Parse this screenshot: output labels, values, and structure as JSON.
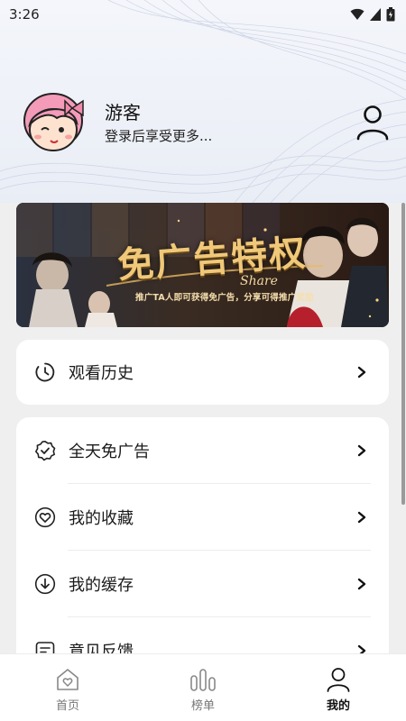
{
  "status_bar": {
    "time": "3:26"
  },
  "profile": {
    "name": "游客",
    "subtitle": "登录后享受更多..."
  },
  "banner": {
    "title": "免广告特权",
    "script": "Share",
    "subtitle": "推广TA人即可获得免广告，分享可得推广奖励"
  },
  "menu": {
    "history": {
      "label": "观看历史",
      "icon": "clock-icon"
    },
    "items": [
      {
        "label": "全天免广告",
        "icon": "badge-check-icon"
      },
      {
        "label": "我的收藏",
        "icon": "heart-icon"
      },
      {
        "label": "我的缓存",
        "icon": "download-icon"
      },
      {
        "label": "意见反馈",
        "icon": "feedback-icon"
      }
    ]
  },
  "tabbar": {
    "tabs": [
      {
        "label": "首页",
        "icon": "home-heart-icon",
        "active": false
      },
      {
        "label": "榜单",
        "icon": "bar-chart-icon",
        "active": false
      },
      {
        "label": "我的",
        "icon": "user-icon",
        "active": true
      }
    ]
  },
  "colors": {
    "banner_gold": "#f0c879",
    "active_tab": "#111111",
    "inactive_tab": "#777777"
  }
}
